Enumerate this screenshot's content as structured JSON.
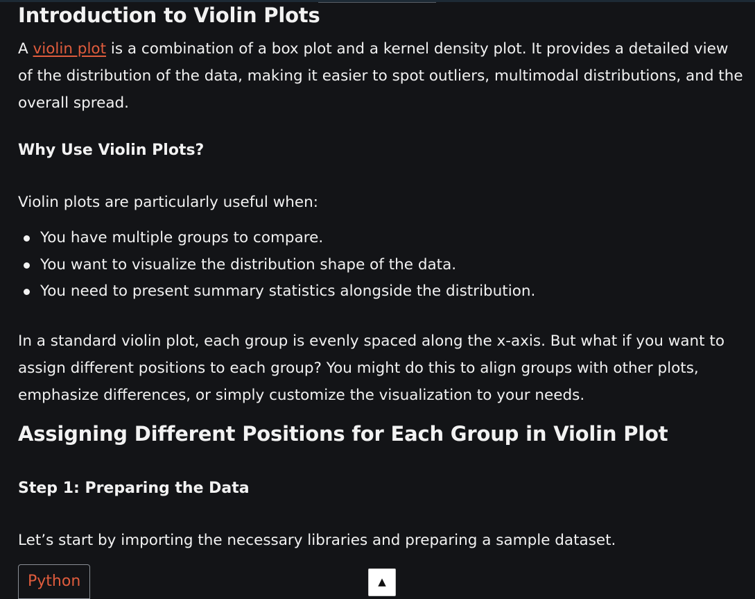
{
  "article": {
    "title": "Introduction to Violin Plots",
    "intro_prefix": "A ",
    "intro_link": "violin plot",
    "intro_rest": " is a combination of a box plot and a kernel density plot. It provides a detailed view of the distribution of the data, making it easier to spot outliers, multimodal distributions, and the overall spread.",
    "why_heading": "Why Use Violin Plots?",
    "useful_when": "Violin plots are particularly useful when:",
    "bullets": [
      "You have multiple groups to compare.",
      "You want to visualize the distribution shape of the data.",
      "You need to present summary statistics alongside the distribution."
    ],
    "standard_paragraph": "In a standard violin plot, each group is evenly spaced along the x-axis. But what if you want to assign different positions to each group? You might do this to align groups with other plots, emphasize differences, or simply customize the visualization to your needs.",
    "section_heading": "Assigning Different Positions for Each Group in Violin Plot",
    "step1_heading": "Step 1: Preparing the Data",
    "step1_text": "Let’s start by importing the necessary libraries and preparing a sample dataset.",
    "code_tab_label": "Python"
  },
  "scroll_top": {
    "icon": "▲"
  },
  "colors": {
    "background": "#131417",
    "text": "#f2f2f2",
    "accent": "#e05c3d"
  }
}
